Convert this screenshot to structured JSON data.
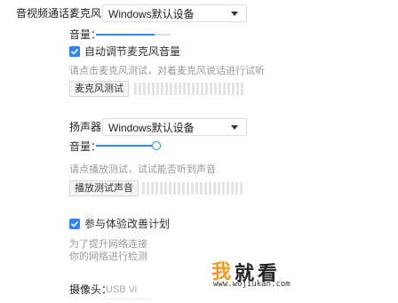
{
  "section": {
    "title": "音视频通话："
  },
  "microphone": {
    "label": "麦克风：",
    "device": "Windows默认设备",
    "volume_label": "音量：",
    "volume_level": 0.78,
    "auto_adjust_label": "自动调节麦克风音量",
    "auto_adjust_checked": true,
    "hint": "请点击麦克风测试，对着麦克风说话进行试听",
    "test_button": "麦克风测试"
  },
  "speaker": {
    "label": "扬声器：",
    "device": "Windows默认设备",
    "volume_label": "音量：",
    "volume_level": 0.95,
    "hint": "请点播放测试，试试能否听到声音",
    "test_button": "播放测试声音"
  },
  "experience": {
    "label": "参与体验改善计划",
    "checked": true,
    "desc_line1": "为了提升网络连接",
    "desc_line2": "你的网络进行检测"
  },
  "camera": {
    "label": "摄像头：",
    "device": "USB Vi"
  },
  "watermark": {
    "char1": "我",
    "char2": "就",
    "char3": "看",
    "url": "www.wojiukan.com"
  },
  "colors": {
    "accent": "#2f86f6",
    "watermark_orange": "#f39a1e"
  }
}
